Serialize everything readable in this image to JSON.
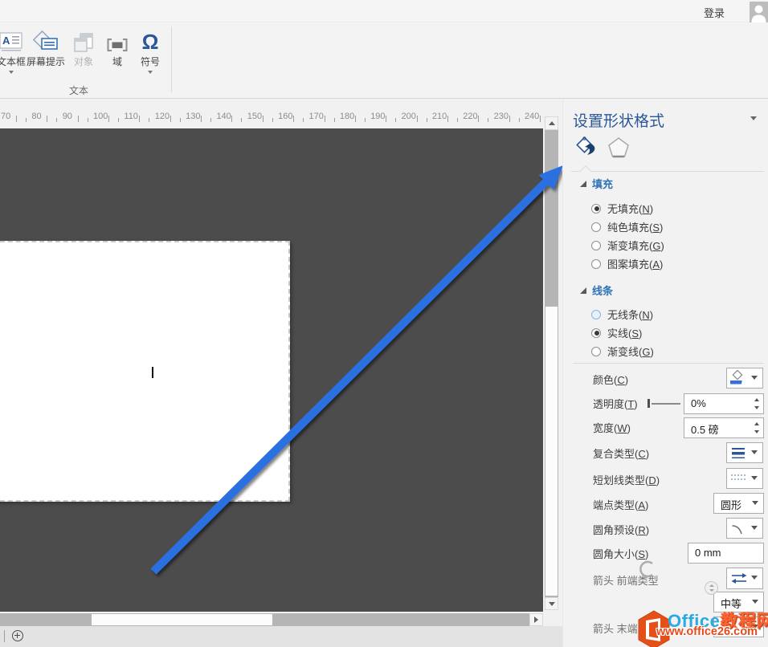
{
  "titlebar": {
    "sign_in_label": "登录"
  },
  "ribbon": {
    "group_label": "文本",
    "buttons": [
      {
        "label": "文本框",
        "dropdown": true,
        "disabled": false
      },
      {
        "label": "屏幕提示",
        "dropdown": false,
        "disabled": false
      },
      {
        "label": "对象",
        "dropdown": false,
        "disabled": true
      },
      {
        "label": "域",
        "dropdown": false,
        "disabled": false
      },
      {
        "label": "符号",
        "dropdown": true,
        "disabled": false
      }
    ]
  },
  "ruler": {
    "ticks": [
      "70",
      "80",
      "90",
      "100",
      "110",
      "120",
      "130",
      "140",
      "150",
      "160",
      "170",
      "180",
      "190",
      "200",
      "210",
      "220",
      "230",
      "240"
    ]
  },
  "panel": {
    "title": "设置形状格式",
    "tabs": [
      {
        "name": "fill-line",
        "icon": "paint-bucket-icon",
        "selected": true
      },
      {
        "name": "layout-properties",
        "icon": "pentagon-icon",
        "selected": false
      }
    ],
    "fill_section": {
      "title": "填充",
      "options": [
        {
          "label": "无填充(N)",
          "selected": true
        },
        {
          "label": "纯色填充(S)",
          "selected": false
        },
        {
          "label": "渐变填充(G)",
          "selected": false
        },
        {
          "label": "图案填充(A)",
          "selected": false
        }
      ]
    },
    "line_section": {
      "title": "线条",
      "options": [
        {
          "label": "无线条(N)",
          "selected": false
        },
        {
          "label": "实线(S)",
          "selected": true
        },
        {
          "label": "渐变线(G)",
          "selected": false
        }
      ]
    },
    "rows": {
      "color": {
        "label": "颜色(C)"
      },
      "transparency": {
        "label": "透明度(T)",
        "value": "0%"
      },
      "width": {
        "label": "宽度(W)",
        "value": "0.5 磅"
      },
      "compound": {
        "label": "复合类型(C)"
      },
      "dash": {
        "label": "短划线类型(D)"
      },
      "cap": {
        "label": "端点类型(A)",
        "value": "圆形"
      },
      "join_preset": {
        "label": "圆角预设(R)"
      },
      "join_size": {
        "label": "圆角大小(S)",
        "value": "0 mm"
      },
      "arrow_begin_type": {
        "label": "箭头 前端类型"
      },
      "arrow_begin_size": {
        "value": "中等"
      },
      "arrow_end_type": {
        "label": "箭头 末端类型"
      }
    }
  },
  "watermark": {
    "brand_office": "Office",
    "brand_suffix": "教程网",
    "url": "www.office26.com"
  },
  "colors": {
    "accent": "#2b579a",
    "section_header": "#2e74b5",
    "arrow_blue": "#2a6fe0",
    "canvas_gray": "#4c4c4c",
    "watermark_blue": "#29abe2",
    "watermark_orange": "#e8491b"
  }
}
